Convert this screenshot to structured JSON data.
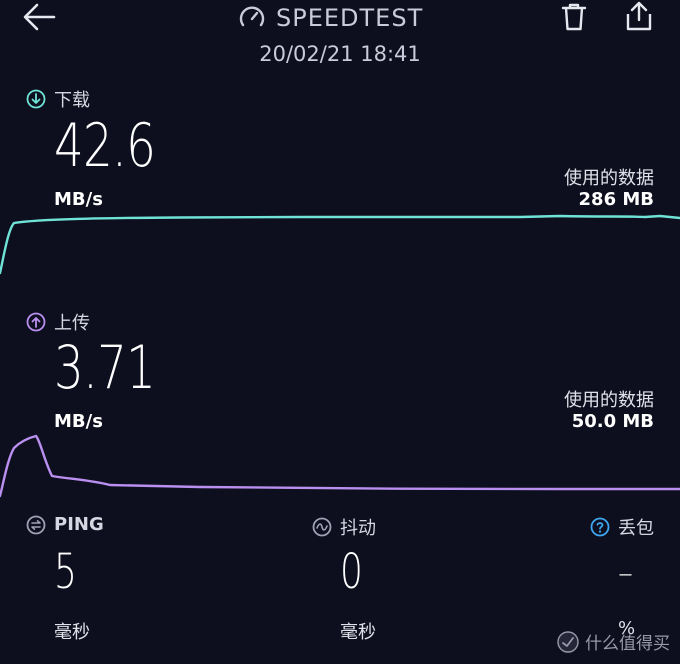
{
  "header": {
    "title": "SPEEDTEST",
    "timestamp": "20/02/21 18:41"
  },
  "download": {
    "label": "下载",
    "value": "42.6",
    "unit": "MB/s",
    "data_used_label": "使用的数据",
    "data_used_value": "286 MB",
    "color": "#6fe3d6"
  },
  "upload": {
    "label": "上传",
    "value": "3.71",
    "unit": "MB/s",
    "data_used_label": "使用的数据",
    "data_used_value": "50.0 MB",
    "color": "#b98ff0"
  },
  "metrics": {
    "ping": {
      "label": "PING",
      "value": "5",
      "unit": "毫秒"
    },
    "jitter": {
      "label": "抖动",
      "value": "0",
      "unit": "毫秒"
    },
    "packet_loss": {
      "label": "丢包",
      "value": "–",
      "unit": "%"
    }
  },
  "watermark": {
    "text": "什么值得买"
  },
  "colors": {
    "background": "#0e0f1e",
    "download": "#6fe3d6",
    "upload": "#b98ff0",
    "info": "#3fa7f0"
  }
}
